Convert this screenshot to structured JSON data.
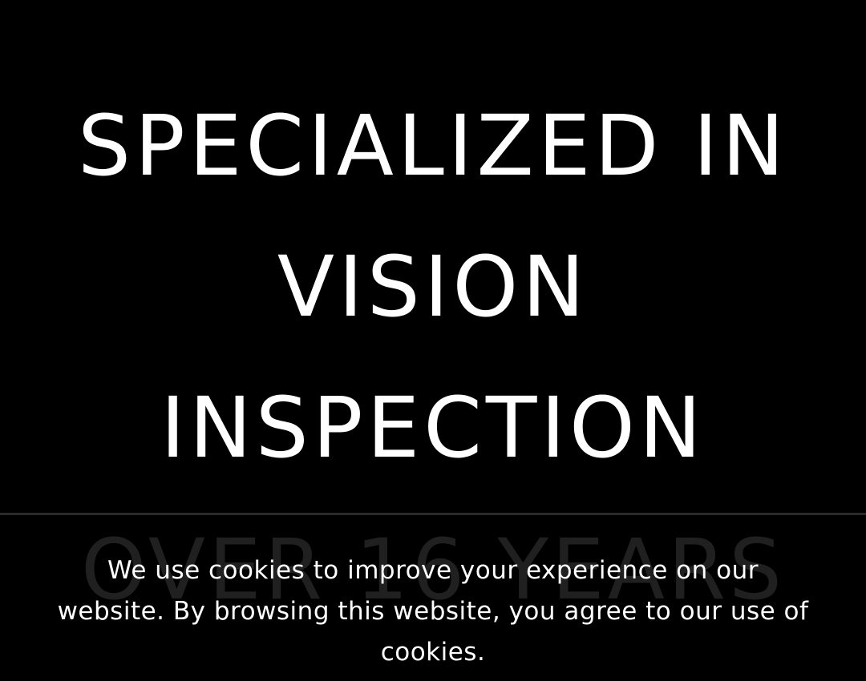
{
  "hero": {
    "title_lines": [
      "SPECIALIZED IN",
      "VISION",
      "INSPECTION"
    ]
  },
  "tagline": "OVER 16 YEARS",
  "cookie_banner": {
    "message": "We use cookies to improve your experience on our website. By browsing this website, you agree to our use of cookies."
  },
  "colors": {
    "background": "#000000",
    "text": "#ffffff",
    "tagline": "#3b3b3b",
    "divider": "#2a2a2a"
  }
}
